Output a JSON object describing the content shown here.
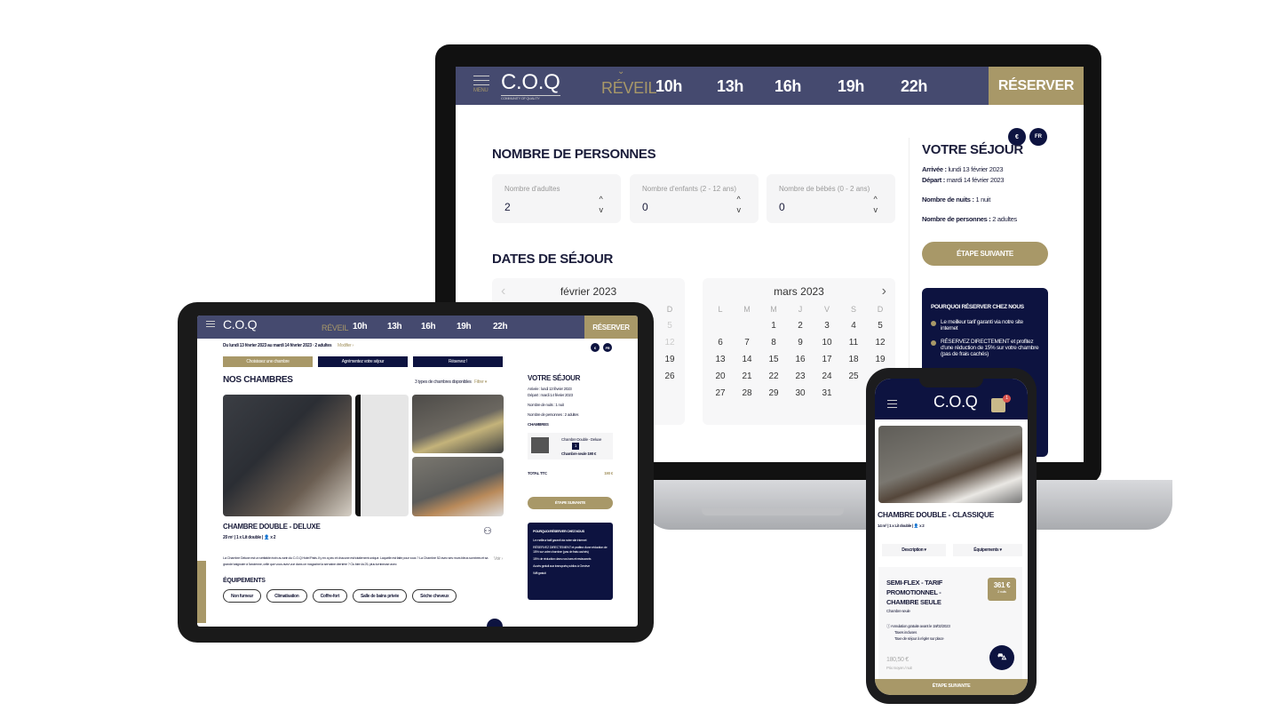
{
  "colors": {
    "header": "#454a6f",
    "gold": "#a89868",
    "navy": "#0d1340",
    "panel": "#f5f5f6"
  },
  "brand": {
    "logo": "C.O.Q",
    "tagline": "COMMUNITY OF QUALITY",
    "menu": "MENU"
  },
  "nav": {
    "items": [
      "RÉVEIL",
      "10h",
      "13h",
      "16h",
      "19h",
      "22h"
    ],
    "reserve": "RÉSERVER"
  },
  "badges": {
    "currency": "€",
    "lang": "FR"
  },
  "laptop": {
    "persons_title": "NOMBRE DE PERSONNES",
    "steppers": [
      {
        "label": "Nombre d'adultes",
        "value": "2"
      },
      {
        "label": "Nombre d'enfants (2 - 12 ans)",
        "value": "0"
      },
      {
        "label": "Nombre de bébés (0 - 2 ans)",
        "value": "0"
      }
    ],
    "dates_title": "DATES DE SÉJOUR",
    "weekdays": [
      "L",
      "M",
      "M",
      "J",
      "V",
      "S",
      "D"
    ],
    "feb": {
      "title": "février 2023"
    },
    "mar": {
      "title": "mars 2023"
    },
    "sejour": {
      "title": "VOTRE SÉJOUR",
      "arrival_label": "Arrivée :",
      "arrival": "lundi 13 février 2023",
      "departure_label": "Départ :",
      "departure": "mardi 14 février 2023",
      "nights_label": "Nombre de nuits :",
      "nights": "1 nuit",
      "persons_label": "Nombre de personnes :",
      "persons": "2 adultes",
      "next": "ÉTAPE SUIVANTE"
    },
    "why": {
      "title": "POURQUOI RÉSERVER CHEZ NOUS",
      "items": [
        "Le meilleur tarif garanti via notre site internet",
        "RÉSERVEZ DIRECTEMENT et profitez d'une réduction de 15% sur votre chambre (pas de frais cachés)"
      ]
    }
  },
  "tablet": {
    "summary": "Du lundi 13 février 2023 au mardi 14 février 2023 · 2 adultes",
    "modify": "Modifier ›",
    "steps": [
      "Choisissez une chambre",
      "Agrémentez votre séjour",
      "Réservez !"
    ],
    "rooms_title": "NOS CHAMBRES",
    "rooms_count": "3 types de chambres disponibles",
    "filter": "Filtrer ▾",
    "room": {
      "name": "CHAMBRE DOUBLE - DELUXE",
      "size": "20 m²",
      "bed": "1 x Lit double",
      "guests": "x 2",
      "desc": "La Chambre Deluxe est un véritable écrin au sein du C.O.Q Hotel Paris. Il y en a peu et chacune est totalement unique. Laquelle est faite pour vous ? La Chambre 52 avec ses murs bleus sombres et sa grande baignoire à l'ancienne, celle que vous avez vue dans ce magazine la semaine dernière ? Ou bien la 25, plus lumineuse avec",
      "more": "Voir ›"
    },
    "equip_title": "ÉQUIPEMENTS",
    "equipments": [
      "Non fumeur",
      "Climatisation",
      "Coffre-fort",
      "Salle de bains privée",
      "Sèche cheveux"
    ],
    "sejour": {
      "title": "VOTRE SÉJOUR",
      "arrival": "Arrivée : lundi 13 février 2023",
      "departure": "Départ : mardi 14 février 2023",
      "nights": "Nombre de nuits : 1 nuit",
      "persons": "Nombre de personnes : 2 adultes",
      "rooms_label": "CHAMBRES",
      "room_name": "Chambre Double - Deluxe",
      "qty": "1",
      "room_price": "Chambre seule 190 €",
      "total_label": "TOTAL TTC",
      "total": "190 €",
      "next": "ÉTAPE SUIVANTE"
    },
    "why": {
      "title": "POURQUOI RÉSERVER CHEZ NOUS",
      "items": [
        "Le meilleur tarif garanti via notre site internet",
        "RÉSERVEZ DIRECTEMENT et profitez d'une réduction de 15% sur votre chambre (pas de frais cachés)",
        "15% de réduction dans nos bars et restaurants",
        "Accès gratuit aux transports publics à Genève",
        "Wifi gratuit"
      ]
    }
  },
  "phone": {
    "cart_count": "1",
    "room": {
      "name": "CHAMBRE DOUBLE - CLASSIQUE",
      "size": "14 m²",
      "bed": "1 x Lit double",
      "guests": "x 2"
    },
    "tabs": [
      "Description ▾",
      "Équipements ▾"
    ],
    "offer": {
      "title": "SEMI-FLEX - TARIF PROMOTIONNEL - CHAMBRE SEULE",
      "subtitle": "Chambre seule",
      "price": "361 €",
      "price_note": "2 nuits",
      "conditions": [
        "Annulation gratuite avant le 18/02/2023",
        "Taxes incluses",
        "Taxe de séjour à régler sur place"
      ],
      "avg_price": "180,50 €",
      "avg_label": "Prix moyen / nuit"
    },
    "next": "ÉTAPE SUIVANTE"
  }
}
